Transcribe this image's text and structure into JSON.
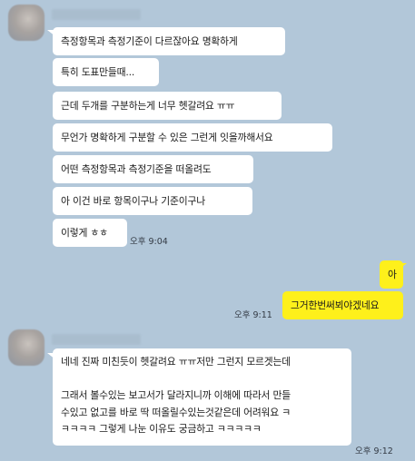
{
  "colors": {
    "background": "#b2c7d9",
    "other_bubble": "#ffffff",
    "my_bubble": "#fef01b"
  },
  "messages_group1": [
    "측정항목과 측정기준이 다르잖아요 명확하게",
    "특히 도표만들때...",
    "근데 두개를 구분하는게 너무 헷갈려요 ㅠㅠ",
    "무언가 명확하게 구분할 수 있은 그런게 잇을까해서요",
    "어떤 측정항목과 측정기준을 떠올려도",
    "아 이건 바로 항목이구나 기준이구나",
    "이렇게 ㅎㅎ"
  ],
  "time_group1": "오후 9:04",
  "my_messages": [
    "아",
    "그거한번써뵈야겠네요"
  ],
  "time_my": "오후 9:11",
  "messages_group2": [
    "네네 진짜 미친듯이 헷갈려요 ㅠㅠ저만 그런지 모르겟는데\n\n그래서 볼수있는 보고서가 달라지니까 이해에 따라서 만들\n수있고 없고를 바로 딱 떠올릴수있는것같은데 어려워요 ㅋ\nㅋㅋㅋㅋ 그렇게 나눈 이유도 궁금하고 ㅋㅋㅋㅋㅋ"
  ],
  "time_group2": "오후 9:12"
}
